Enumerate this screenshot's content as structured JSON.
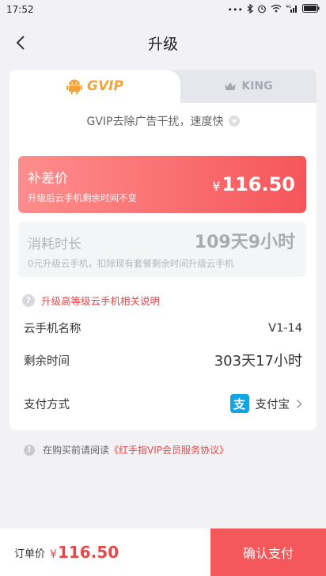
{
  "status": {
    "time": "17:52",
    "net": "4G",
    "battery": ""
  },
  "nav": {
    "title": "升级"
  },
  "tabs": [
    {
      "label": "GVIP"
    },
    {
      "label": "KING"
    }
  ],
  "desc": "GVIP去除广告干扰，速度快",
  "diff_price": {
    "title": "补差价",
    "subtitle": "升级后云手机剩余时间不变",
    "currency": "¥",
    "amount": "116.50"
  },
  "consume": {
    "title": "消耗时长",
    "subtitle": "0元升级云手机，扣除现有套餐剩余时间升级云手机",
    "value": "109天9小时"
  },
  "help_link": "升级高等级云手机相关说明",
  "phone_name": {
    "label": "云手机名称",
    "value": "V1-14"
  },
  "remaining": {
    "label": "剩余时间",
    "value": "303天17小时"
  },
  "payment": {
    "label": "支付方式",
    "method": "支付宝",
    "icon_glyph": "支"
  },
  "agreement": {
    "prefix": "在购买前请阅读",
    "link": "《红手指VIP会员服务协议》"
  },
  "bottom": {
    "label": "订单价",
    "currency": "¥",
    "amount": "116.50",
    "confirm": "确认支付"
  },
  "colors": {
    "accent": "#f4585b",
    "gvip_gold": "#f2a43a",
    "alipay_blue": "#12a4e4"
  }
}
